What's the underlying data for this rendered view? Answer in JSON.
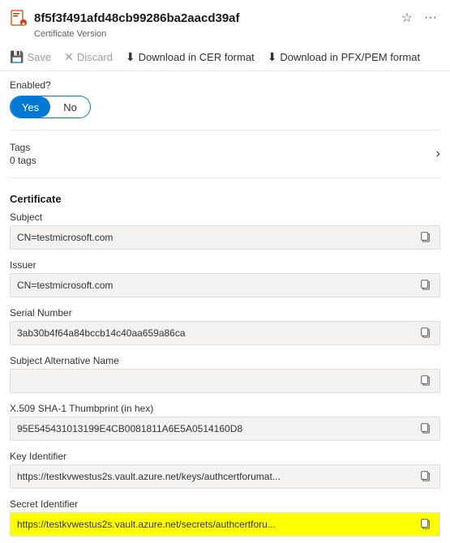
{
  "header": {
    "title": "8f5f3f491afd48cb99286ba2aacd39af",
    "subtitle": "Certificate Version",
    "pin_icon": "☆",
    "more_icon": "···"
  },
  "toolbar": {
    "save_label": "Save",
    "discard_label": "Discard",
    "download_cer_label": "Download in CER format",
    "download_pfx_label": "Download in PFX/PEM format"
  },
  "enabled": {
    "label": "Enabled?",
    "yes_label": "Yes",
    "no_label": "No"
  },
  "tags": {
    "label": "Tags",
    "count": "0 tags"
  },
  "certificate": {
    "section_title": "Certificate",
    "fields": [
      {
        "label": "Subject",
        "value": "CN=testmicrosoft.com",
        "highlighted": false
      },
      {
        "label": "Issuer",
        "value": "CN=testmicrosoft.com",
        "highlighted": false
      },
      {
        "label": "Serial Number",
        "value": "3ab30b4f64a84bccb14c40aa659a86ca",
        "highlighted": false
      },
      {
        "label": "Subject Alternative Name",
        "value": "",
        "highlighted": false
      },
      {
        "label": "X.509 SHA-1 Thumbprint (in hex)",
        "value": "95E545431013199E4CB0081811A6E5A0514160D8",
        "highlighted": false
      },
      {
        "label": "Key Identifier",
        "value": "https://testkvwestus2s.vault.azure.net/keys/authcertforumat...",
        "highlighted": false
      },
      {
        "label": "Secret Identifier",
        "value": "https://testkvwestus2s.vault.azure.net/secrets/authcertforu...",
        "highlighted": true
      }
    ]
  }
}
